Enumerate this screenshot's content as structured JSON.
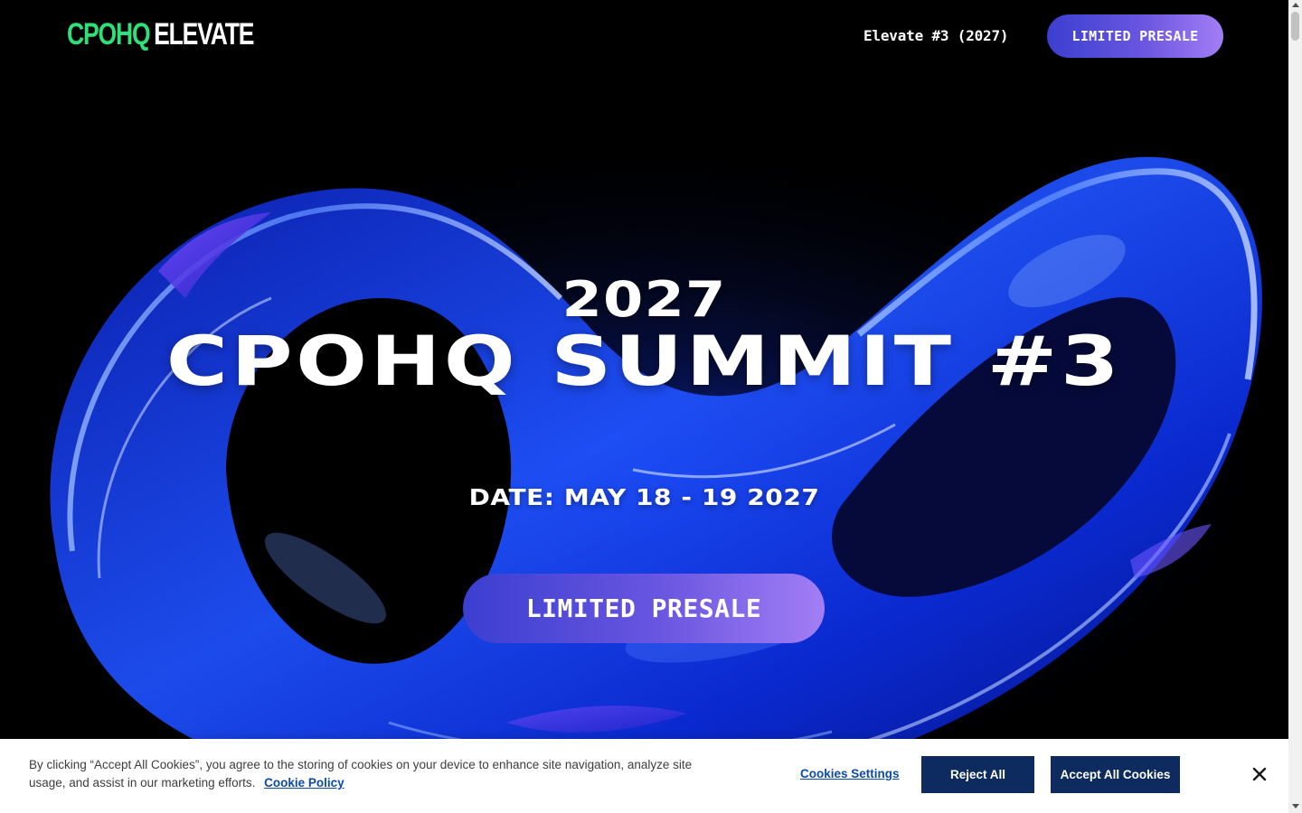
{
  "header": {
    "logo_part1": "CPOHQ",
    "logo_part2": "ELEVATE",
    "nav_link": "Elevate #3 (2027)",
    "cta_label": "LIMITED PRESALE"
  },
  "hero": {
    "year": "2027",
    "title": "CPOHQ SUMMIT #3",
    "date": "DATE: MAY 18 - 19 2027",
    "cta_label": "LIMITED PRESALE"
  },
  "cookie_banner": {
    "text": "By clicking “Accept All Cookies”, you agree to the storing of cookies on your device to enhance site navigation, analyze site usage, and assist in our marketing efforts.",
    "policy_link": "Cookie Policy",
    "settings_label": "Cookies Settings",
    "reject_label": "Reject All",
    "accept_label": "Accept All Cookies",
    "close_icon": "close-icon"
  },
  "colors": {
    "logo_accent": "#2ee07a",
    "gradient_start": "#3b3fd0",
    "gradient_end": "#a37ef5",
    "cookie_button": "#0d2b5e",
    "cookie_link": "#0b4aa8"
  }
}
